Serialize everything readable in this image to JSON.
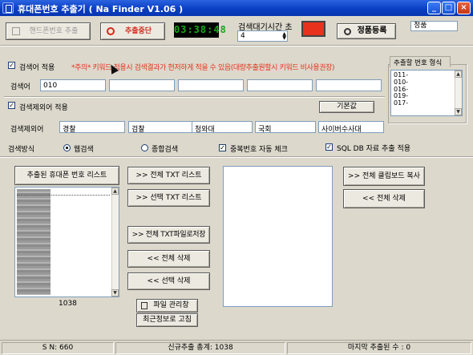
{
  "window": {
    "title": "휴대폰번호 추출기 ( Na Finder V1.06 )",
    "min_label": "_",
    "max_label": "□",
    "close_label": "×"
  },
  "toolbar": {
    "extract_label": "핸드폰번호 추출",
    "stop_label": "추출중단",
    "timer": "03:38:48",
    "wait_time_label": "검색대기시간 초",
    "wait_time_value": "4",
    "register_label": "정품등록",
    "license_status": "정품"
  },
  "keyword": {
    "apply_label": "검색어 적용",
    "apply_checked": true,
    "notice": "*주의* 키워드 적용시 검색결과가 현저하게 적을 수 있음(대량추출원할시 키워드 비사용권장)",
    "row_label": "검색어",
    "inputs": [
      "010",
      "",
      "",
      "",
      ""
    ]
  },
  "exclude": {
    "apply_label": "검색제외어 적용",
    "apply_checked": true,
    "default_button": "기본값",
    "row_label": "검색제외어",
    "inputs": [
      "경찰",
      "검찰",
      "청와대",
      "국회",
      "사이버수사대"
    ]
  },
  "formats": {
    "title": "추출할 번호 형식",
    "items": [
      "011-",
      "010-",
      "016-",
      "019-",
      "017-"
    ]
  },
  "search": {
    "method_label": "검색방식",
    "options": [
      "웹검색",
      "종합검색"
    ],
    "selected": "웹검색",
    "dup_check_label": "중복번호 자동 체크",
    "dup_checked": true,
    "sql_label": "SQL DB 자료 추출 적용",
    "sql_checked": true
  },
  "extracted": {
    "header": "추출된 휴대폰 번호 리스트",
    "count": "1038"
  },
  "actions": {
    "all_txt": ">> 전체 TXT 리스트",
    "selected_txt": ">> 선택 TXT 리스트",
    "save_all_txt": ">> 전체 TXT파일로저장",
    "delete_all": "<< 전체 삭제",
    "delete_selected": "<< 선택 삭제",
    "file_manager": "파일 관리창",
    "update_info": "최근정보로 고침"
  },
  "right_actions": {
    "copy_all": ">> 전체 클립보드 복사",
    "delete_all": "<< 전체 삭제"
  },
  "status": {
    "sn": "S N: 660",
    "total": "신규추출 총계: 1038",
    "last": "마지막 추출된 수 : 0"
  },
  "colors": {
    "titlebar": "#0a3fc4",
    "notice": "#e8321c",
    "stop_red": "#d42a1c",
    "lcd_text": "#18a818",
    "indicator": "#e8321c"
  }
}
